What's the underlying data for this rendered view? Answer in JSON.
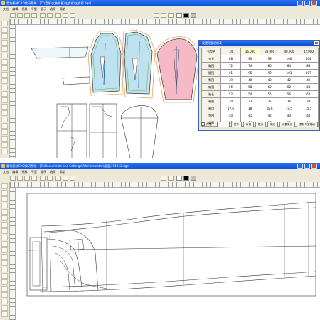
{
  "top_window": {
    "title": "富怡服装CAD放码系统 - [C:\\富怡\\女装样板\\连衣裙\\连衣裙.dgs]",
    "menu": [
      "文档",
      "编辑",
      "纸样",
      "号型",
      "显示",
      "选项",
      "帮助"
    ],
    "dialog": {
      "title": "设置号型规格表",
      "columns": [
        "号型名",
        "34",
        "36.000",
        "38.000",
        "40.000",
        "42.000"
      ],
      "base_size": "36.000",
      "rows": [
        {
          "name": "衣长",
          "values": [
            "88",
            "90",
            "99",
            "100",
            "104"
          ]
        },
        {
          "name": "胸围",
          "values": [
            "72",
            "74",
            "80",
            "84",
            "88"
          ]
        },
        {
          "name": "腰围",
          "values": [
            "91",
            "95",
            "99",
            "103",
            "107"
          ]
        },
        {
          "name": "臀围",
          "values": [
            "39",
            "40",
            "40",
            "42",
            "42"
          ]
        },
        {
          "name": "肩宽",
          "values": [
            "56",
            "58",
            "60",
            "62",
            "64"
          ]
        },
        {
          "name": "袖长",
          "values": [
            "52",
            "54",
            "55",
            "56",
            "60"
          ]
        },
        {
          "name": "袖肥",
          "values": [
            "30",
            "33",
            "35",
            "36",
            "38"
          ]
        },
        {
          "name": "袖口",
          "values": [
            "17.6",
            "18",
            "18.6",
            "19.5",
            "15.5"
          ]
        },
        {
          "name": "领围",
          "values": [
            "40",
            "41",
            "42",
            "43",
            "44"
          ]
        },
        {
          "name": "前腰",
          "values": [
            "35",
            "36",
            "37",
            "38",
            "39"
          ]
        }
      ],
      "footer": {
        "checkbox_label": "存储",
        "buttons": [
          "打开",
          "存储",
          "取消",
          "确定",
          "设置单位",
          "删除号型规格"
        ]
      }
    }
  },
  "bottom_window": {
    "title": "富怡服装CAD放码系统 - [C:\\Documents and Settings\\Administrator\\桌面\\701012.dgs]",
    "menu": [
      "文档",
      "编辑",
      "纸样",
      "号型",
      "显示",
      "选项",
      "帮助"
    ]
  },
  "colors": {
    "titlebar": "#0a4fd9",
    "chrome": "#ece9d8",
    "bodice_front_fill": "#bfe2f0",
    "bodice_back_fill": "#bfe2f0",
    "sleeve_fill": "#f6b9c6",
    "grade_orange": "#e7892b",
    "grade_green": "#6aa84f",
    "pattern_line": "#333333"
  },
  "icons": {
    "toolbar": [
      "new-icon",
      "open-icon",
      "save-icon",
      "print-icon",
      "undo-icon",
      "redo-icon",
      "zoom-icon",
      "grid-icon",
      "measure-icon",
      "palette-icon"
    ],
    "tools": [
      "pointer-icon",
      "pen-icon",
      "line-icon",
      "curve-icon",
      "circle-icon",
      "knife-icon",
      "notch-icon",
      "dart-icon",
      "fold-icon",
      "rotate-icon",
      "mirror-icon",
      "text-icon",
      "ruler-icon",
      "grade-icon",
      "seam-icon",
      "button-icon",
      "pleat-icon",
      "eraser-icon",
      "select-icon",
      "move-icon",
      "measure-tool-icon",
      "hand-icon",
      "zoom-tool-icon"
    ]
  }
}
